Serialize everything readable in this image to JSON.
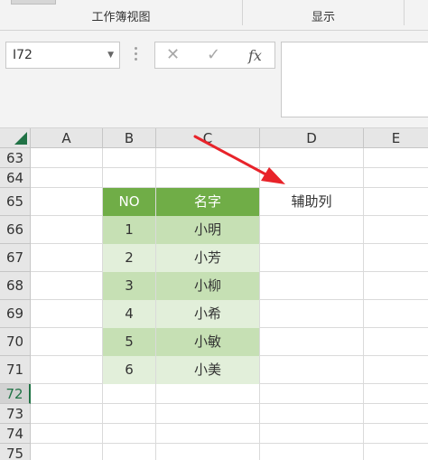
{
  "ribbon": {
    "group1": "工作簿视图",
    "group2": "显示"
  },
  "formula_bar": {
    "name_box": "I72",
    "cancel_glyph": "✕",
    "enter_glyph": "✓",
    "fx_glyph": "fx",
    "value": ""
  },
  "grid": {
    "columns": [
      "A",
      "B",
      "C",
      "D",
      "E"
    ],
    "rows": [
      "63",
      "64",
      "65",
      "66",
      "67",
      "68",
      "69",
      "70",
      "71",
      "72",
      "73",
      "74",
      "75"
    ],
    "selected_row": "72",
    "table_header": {
      "no": "NO",
      "name": "名字"
    },
    "helper_column_label": "辅助列",
    "table_rows": [
      {
        "no": "1",
        "name": "小明"
      },
      {
        "no": "2",
        "name": "小芳"
      },
      {
        "no": "3",
        "name": "小柳"
      },
      {
        "no": "4",
        "name": "小希"
      },
      {
        "no": "5",
        "name": "小敏"
      },
      {
        "no": "6",
        "name": "小美"
      }
    ]
  },
  "colors": {
    "header_green": "#70ad47",
    "band_dark": "#c6e0b4",
    "band_light": "#e2efda",
    "arrow_red": "#e8232a",
    "excel_green": "#217346"
  },
  "icons": {
    "corner": "select-all-triangle-icon",
    "arrow": "red-arrow-annotation"
  }
}
